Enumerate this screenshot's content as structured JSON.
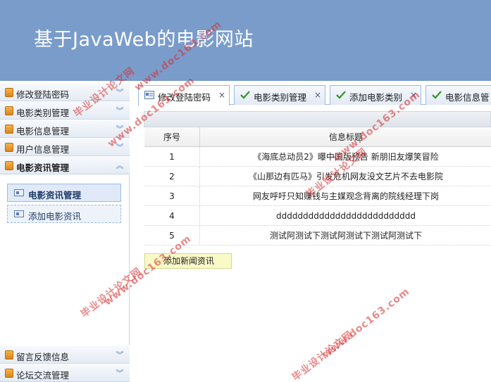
{
  "header": {
    "title": "基于JavaWeb的电影网站"
  },
  "sidebar": {
    "sections": [
      {
        "label": "修改登陆密码",
        "expanded": false
      },
      {
        "label": "电影类别管理",
        "expanded": false
      },
      {
        "label": "电影信息管理",
        "expanded": false
      },
      {
        "label": "用户信息管理",
        "expanded": false
      },
      {
        "label": "电影资讯管理",
        "expanded": true
      },
      {
        "label": "留言反馈信息",
        "expanded": false
      },
      {
        "label": "论坛交流管理",
        "expanded": false
      }
    ],
    "subitems": [
      {
        "label": "电影资讯管理"
      },
      {
        "label": "添加电影资讯"
      }
    ]
  },
  "tabs": [
    {
      "label": "修改登陆密码",
      "close": "×"
    },
    {
      "label": "电影类别管理",
      "close": "×"
    },
    {
      "label": "添加电影类别",
      "close": "×"
    },
    {
      "label": "电影信息管"
    }
  ],
  "table": {
    "columns": [
      "序号",
      "信息标题"
    ],
    "rows": [
      [
        "1",
        "《海底总动员2》曝中国版预告 新朋旧友爆笑冒险"
      ],
      [
        "2",
        "《山那边有匹马》引发危机网友没文艺片不去电影院"
      ],
      [
        "3",
        "网友呼吁只知赚钱与主媒观念背离的院线经理下岗"
      ],
      [
        "4",
        "dddddddddddddddddddddddddd"
      ],
      [
        "5",
        "测试阿测试下测试阿测试下测试阿测试下"
      ]
    ]
  },
  "actions": {
    "add_news": "添加新闻资讯"
  },
  "watermark": {
    "cn": "毕业设计论文网",
    "url": "www.doc163.com"
  },
  "colors": {
    "header_bg": "#7a9ccb",
    "accent_border": "#99bbe8",
    "watermark": "#d62a2a"
  }
}
